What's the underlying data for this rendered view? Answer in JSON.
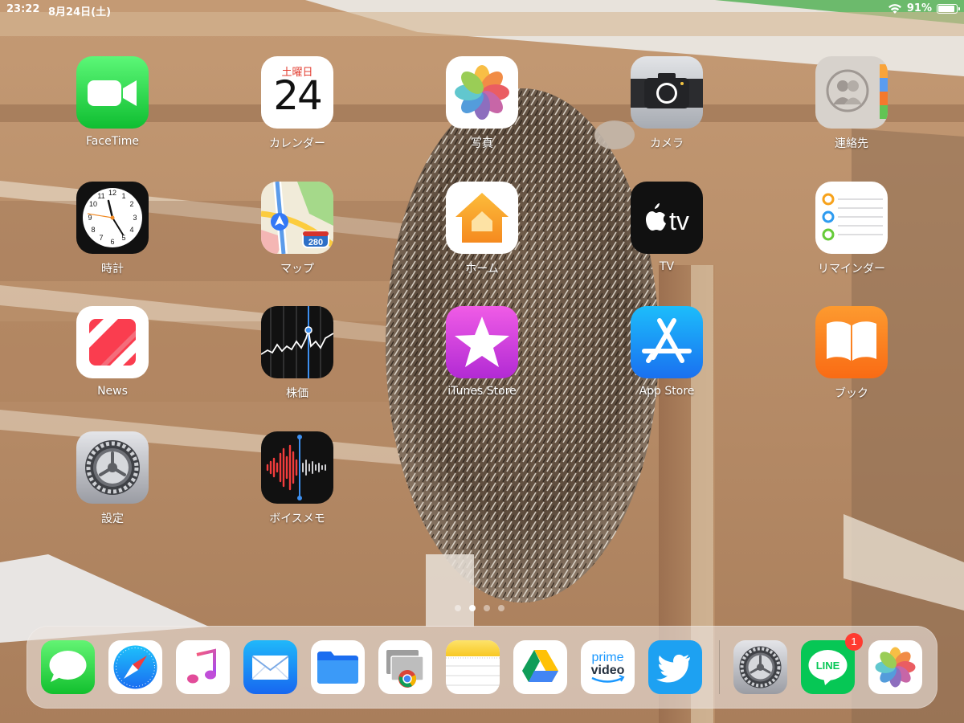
{
  "status_bar": {
    "time": "23:22",
    "date": "8月24日(土)",
    "battery_percent": "91%",
    "battery_level": 0.91,
    "wifi_icon": "wifi-icon"
  },
  "apps": [
    {
      "id": "facetime",
      "label": "FaceTime",
      "icon": "facetime-icon"
    },
    {
      "id": "calendar",
      "label": "カレンダー",
      "icon": "calendar-icon",
      "weekday": "土曜日",
      "day": "24"
    },
    {
      "id": "photos",
      "label": "写真",
      "icon": "photos-icon"
    },
    {
      "id": "camera",
      "label": "カメラ",
      "icon": "camera-icon"
    },
    {
      "id": "contacts",
      "label": "連絡先",
      "icon": "contacts-icon"
    },
    {
      "id": "clock",
      "label": "時計",
      "icon": "clock-icon"
    },
    {
      "id": "maps",
      "label": "マップ",
      "icon": "maps-icon",
      "route_sign": "280"
    },
    {
      "id": "home",
      "label": "ホーム",
      "icon": "home-icon"
    },
    {
      "id": "tv",
      "label": "TV",
      "icon": "tv-icon",
      "icon_text": "tv"
    },
    {
      "id": "reminders",
      "label": "リマインダー",
      "icon": "reminders-icon"
    },
    {
      "id": "news",
      "label": "News",
      "icon": "news-icon"
    },
    {
      "id": "stocks",
      "label": "株価",
      "icon": "stocks-icon"
    },
    {
      "id": "itunes-store",
      "label": "iTunes Store",
      "icon": "itunes-star-icon"
    },
    {
      "id": "app-store",
      "label": "App Store",
      "icon": "app-store-icon"
    },
    {
      "id": "books",
      "label": "ブック",
      "icon": "books-icon"
    },
    {
      "id": "settings",
      "label": "設定",
      "icon": "settings-gear-icon"
    },
    {
      "id": "voice-memos",
      "label": "ボイスメモ",
      "icon": "voice-memos-icon"
    }
  ],
  "page_dots": {
    "count": 4,
    "active_index": 1
  },
  "dock": [
    {
      "id": "messages",
      "icon": "messages-icon"
    },
    {
      "id": "safari",
      "icon": "safari-compass-icon"
    },
    {
      "id": "music",
      "icon": "music-note-icon"
    },
    {
      "id": "mail",
      "icon": "mail-envelope-icon"
    },
    {
      "id": "files",
      "icon": "files-folder-icon"
    },
    {
      "id": "chrome-remote-desktop",
      "icon": "chrome-remote-desktop-icon"
    },
    {
      "id": "notes",
      "icon": "notes-icon"
    },
    {
      "id": "google-drive",
      "icon": "google-drive-icon"
    },
    {
      "id": "prime-video",
      "icon": "prime-video-icon",
      "icon_text_1": "prime",
      "icon_text_2": "video"
    },
    {
      "id": "twitter",
      "icon": "twitter-bird-icon"
    },
    {
      "id": "settings",
      "icon": "settings-gear-icon"
    },
    {
      "id": "line",
      "icon": "line-icon",
      "icon_text": "LINE",
      "badge": "1"
    },
    {
      "id": "photos",
      "icon": "photos-icon"
    }
  ]
}
